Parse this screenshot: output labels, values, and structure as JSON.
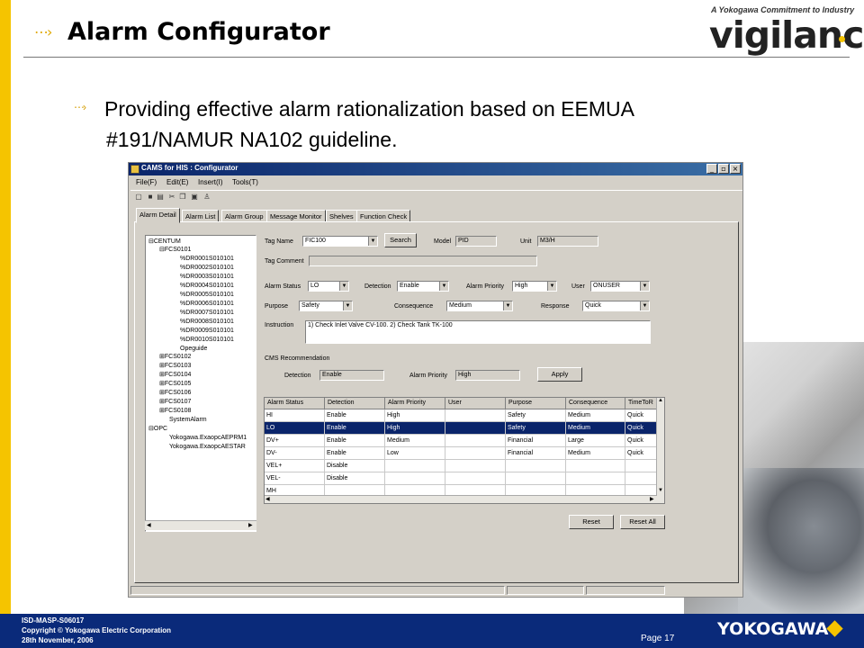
{
  "slide": {
    "title": "Alarm Configurator",
    "bullet_line1": "Providing effective alarm rationalization based on EEMUA",
    "bullet_line2": "#191/NAMUR NA102 guideline.",
    "logo_tagline": "A Yokogawa Commitment to Industry",
    "logo_word": "vigilance",
    "logo_mark": "®"
  },
  "footer": {
    "doc_id": "ISD-MASP-S06017",
    "copyright": "Copyright © Yokogawa Electric Corporation",
    "date": "28th November, 2006",
    "page": "Page  17",
    "brand": "YOKOGAWA"
  },
  "window": {
    "title": "CAMS for HIS : Configurator",
    "menus": [
      "File(F)",
      "Edit(E)",
      "Insert(I)",
      "Tools(T)"
    ],
    "tabs": [
      "Alarm Detail",
      "Alarm List",
      "Alarm Group",
      "Message Monitor",
      "Shelves",
      "Function Check"
    ],
    "tree": [
      "CENTUM",
      "FCS0101",
      "%DR0001S010101",
      "%DR0002S010101",
      "%DR0003S010101",
      "%DR0004S010101",
      "%DR0005S010101",
      "%DR0006S010101",
      "%DR0007S010101",
      "%DR0008S010101",
      "%DR0009S010101",
      "%DR0010S010101",
      "Opeguide",
      "FCS0102",
      "FCS0103",
      "FCS0104",
      "FCS0105",
      "FCS0106",
      "FCS0107",
      "FCS0108",
      "SystemAlarm",
      "OPC",
      "Yokogawa.ExaopcAEPRM1",
      "Yokogawa.ExaopcAESTAR"
    ],
    "form": {
      "tag_name_label": "Tag Name",
      "tag_name": "FIC100",
      "search_label": "Search",
      "model_label": "Model",
      "model": "PID",
      "unit_label": "Unit",
      "unit": "M3/H",
      "tag_comment_label": "Tag Comment",
      "alarm_status_label": "Alarm Status",
      "alarm_status": "LO",
      "detection_label": "Detection",
      "detection": "Enable",
      "alarm_priority_label": "Alarm Priority",
      "alarm_priority": "High",
      "user_label": "User",
      "user": "ONUSER",
      "purpose_label": "Purpose",
      "purpose": "Safety",
      "consequence_label": "Consequence",
      "consequence": "Medium",
      "response_label": "Response",
      "response": "Quick",
      "instruction_label": "Instruction",
      "instruction": "1) Check Inlet Valve CV-100.  2) Check Tank TK-100",
      "cms_label": "CMS Recommendation",
      "cms_detection_label": "Detection",
      "cms_detection": "Enable",
      "cms_priority_label": "Alarm Priority",
      "cms_priority": "High",
      "apply_label": "Apply",
      "reset_label": "Reset",
      "reset_all_label": "Reset All"
    },
    "grid_headers": [
      "Alarm Status",
      "Detection",
      "Alarm Priority",
      "User",
      "Purpose",
      "Consequence",
      "TimeToR"
    ],
    "grid_rows": [
      [
        "HI",
        "Enable",
        "High",
        "",
        "Safety",
        "Medium",
        "Quick"
      ],
      [
        "LO",
        "Enable",
        "High",
        "",
        "Safety",
        "Medium",
        "Quick"
      ],
      [
        "DV+",
        "Enable",
        "Medium",
        "",
        "Financial",
        "Large",
        "Quick"
      ],
      [
        "DV-",
        "Enable",
        "Low",
        "",
        "Financial",
        "Medium",
        "Quick"
      ],
      [
        "VEL+",
        "Disable",
        "",
        "",
        "",
        "",
        ""
      ],
      [
        "VEL-",
        "Disable",
        "",
        "",
        "",
        "",
        ""
      ],
      [
        "MH",
        "",
        "",
        "",
        "",
        "",
        ""
      ]
    ],
    "selected_row": 1
  },
  "colors": {
    "accent_yellow": "#f5c400",
    "footer_blue": "#0a2a7a",
    "selection_blue": "#0a246a",
    "window_gray": "#d4d0c8"
  }
}
